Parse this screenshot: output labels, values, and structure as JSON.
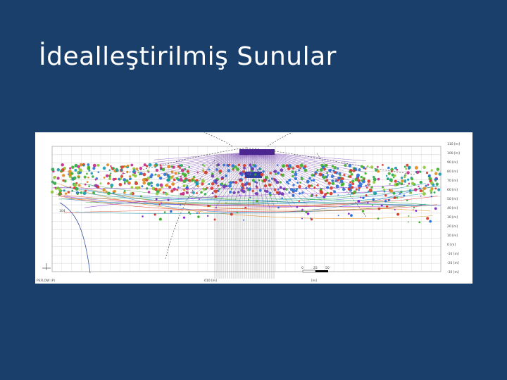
{
  "slide": {
    "title": "İdealleştirilmiş Sunular"
  },
  "figure": {
    "y_axis_labels": [
      "110 [m]",
      "100 [m]",
      "90 [m]",
      "80 [m]",
      "70 [m]",
      "60 [m]",
      "50 [m]",
      "40 [m]",
      "30 [m]",
      "20 [m]",
      "10 [m]",
      "0 [m]",
      "-10 [m]",
      "-20 [m]",
      "-30 [m]"
    ],
    "bottom_left_label": "PEFLOW (P)",
    "bottom_center_label": "610 [m]",
    "scale_labels": [
      "0",
      "25",
      "50"
    ],
    "scale_unit": "[m]",
    "center_label": "113",
    "left_curve_label": "104",
    "colors": {
      "background": "#1a3f6b",
      "title": "#ffffff",
      "fan": "#7a3fb8",
      "grid": "#cccccc"
    }
  }
}
